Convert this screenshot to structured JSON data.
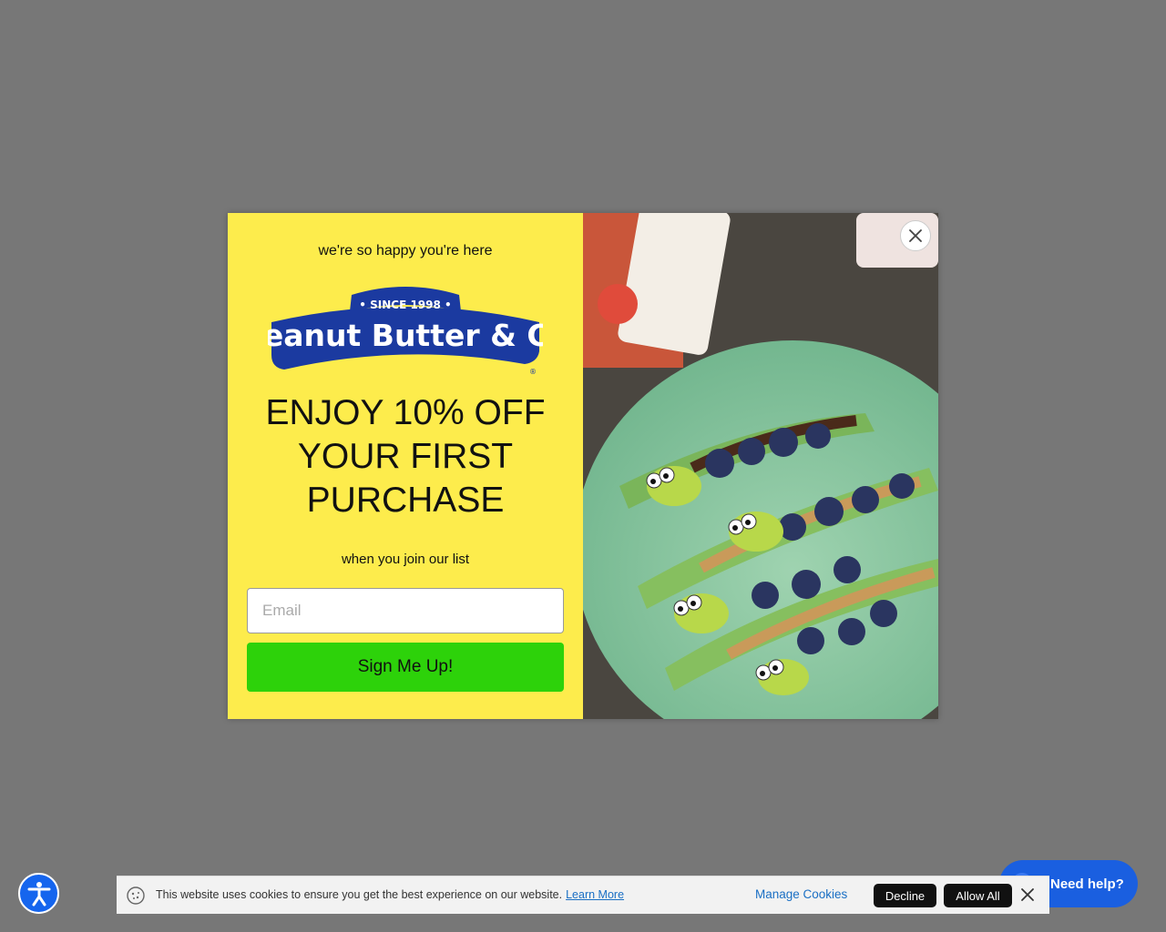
{
  "popup": {
    "tagline": "we're so happy you're here",
    "logo": {
      "since": "• SINCE 1998 •",
      "brand": "Peanut Butter & Co",
      "registered": "®"
    },
    "headline": "ENJOY 10% OFF YOUR FIRST PURCHASE",
    "subtext": "when you join our list",
    "email_placeholder": "Email",
    "email_value": "",
    "signup_label": "Sign Me Up!",
    "colors": {
      "panel": "#fdec4c",
      "button": "#2dd20a",
      "logo_blue": "#1b3aa0"
    }
  },
  "help_widget": {
    "label": "Need help?"
  },
  "cookie_bar": {
    "message": "This website uses cookies to ensure you get the best experience on our website.",
    "learn_more": "Learn More",
    "manage": "Manage Cookies",
    "decline": "Decline",
    "allow_all": "Allow All"
  },
  "icons": [
    "close-icon",
    "accessibility-icon",
    "chat-icon",
    "cookie-icon"
  ]
}
